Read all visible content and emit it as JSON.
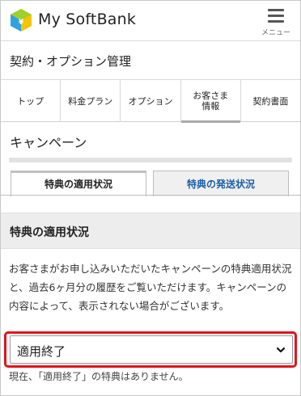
{
  "header": {
    "app_title": "My SoftBank",
    "menu_label": "メニュー",
    "logo_icon": "softbank-logo-icon",
    "menu_icon": "hamburger-menu-icon"
  },
  "page": {
    "title": "契約・オプション管理"
  },
  "nav": {
    "items": [
      {
        "label": "トップ"
      },
      {
        "label": "料金プラン"
      },
      {
        "label": "オプション"
      },
      {
        "label_line1": "お客さま",
        "label_line2": "情報"
      },
      {
        "label": "契約書面"
      }
    ],
    "active_index": 3
  },
  "campaign": {
    "title": "キャンペーン",
    "tabs": [
      {
        "label": "特典の適用状況"
      },
      {
        "label": "特典の発送状況"
      }
    ],
    "status_heading": "特典の適用状況",
    "description": "お客さまがお申し込みいただいたキャンペーンの特典適用状況と、過去6ヶ月分の履歴をご覧いただけます。キャンペーンの内容によって、表示されない場合がございます。",
    "select": {
      "value": "適用終了",
      "chevron_icon": "chevron-down-icon"
    },
    "note": "現在、「適用終了」の特典はありません。"
  },
  "colors": {
    "highlight": "#e0141c",
    "link_tab": "#1a5ea8",
    "band": "#ededed"
  }
}
